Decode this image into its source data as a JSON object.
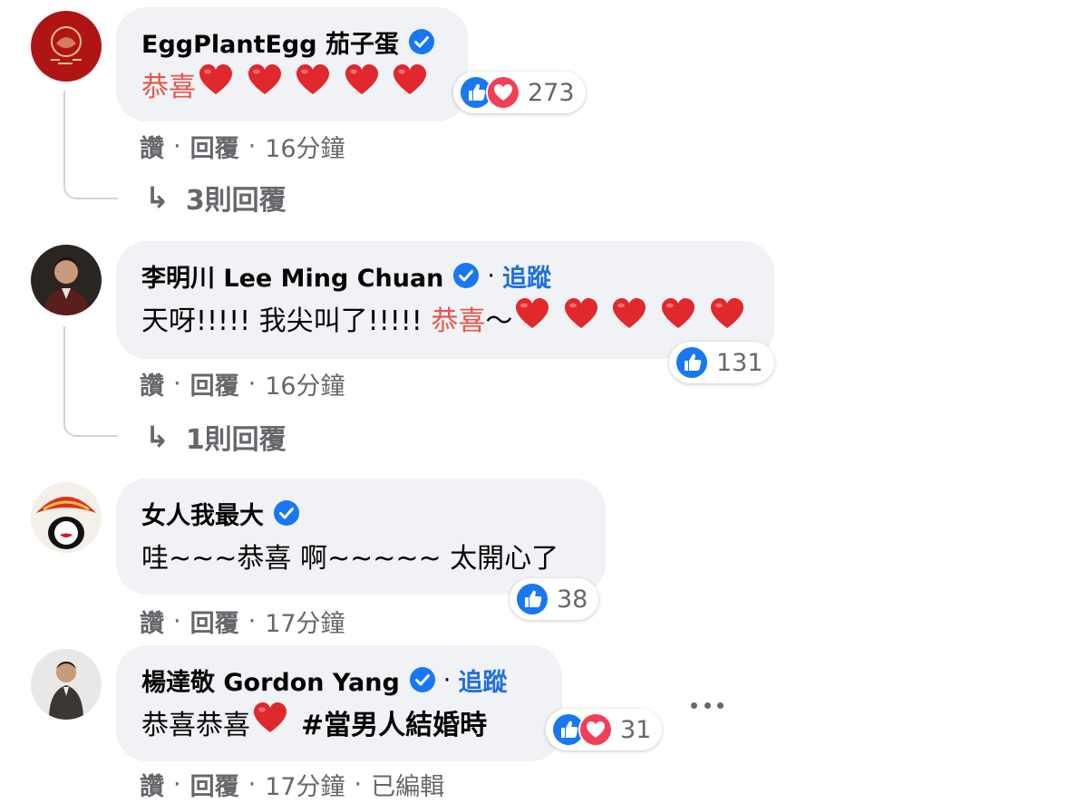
{
  "comments": [
    {
      "author": "EggPlantEgg 茄子蛋",
      "verified": true,
      "text_red": "恭喜",
      "text_pre": "",
      "text_post": "",
      "hearts": 5,
      "reactions": [
        "like",
        "love"
      ],
      "reaction_count": "273",
      "like_label": "讚",
      "reply_label": "回覆",
      "time": "16分鐘",
      "replies_label": "3則回覆"
    },
    {
      "author": "李明川 Lee Ming Chuan",
      "verified": true,
      "follow_label": "追蹤",
      "text_pre": "天呀!!!!! 我尖叫了!!!!! ",
      "text_red": "恭喜",
      "text_post": "～",
      "hearts": 5,
      "reactions": [
        "like"
      ],
      "reaction_count": "131",
      "like_label": "讚",
      "reply_label": "回覆",
      "time": "16分鐘",
      "replies_label": "1則回覆"
    },
    {
      "author": "女人我最大",
      "verified": true,
      "text_pre": "哇~~~恭喜 啊~~~~~ 太開心了",
      "hearts": 0,
      "reactions": [
        "like"
      ],
      "reaction_count": "38",
      "like_label": "讚",
      "reply_label": "回覆",
      "time": "17分鐘"
    },
    {
      "author": "楊達敬 Gordon Yang",
      "verified": true,
      "follow_label": "追蹤",
      "text_pre": "恭喜恭喜",
      "hashtag": "#當男人結婚時",
      "hearts": 1,
      "reactions": [
        "like",
        "love"
      ],
      "reaction_count": "31",
      "like_label": "讚",
      "reply_label": "回覆",
      "time": "17分鐘",
      "edited_label": "已編輯"
    }
  ],
  "separator": "·",
  "reply_arrow": "↳",
  "colors": {
    "bubble": "#f0f2f5",
    "link_blue": "#216fdb",
    "muted": "#65676b",
    "red_text": "#e4564a",
    "heart_red": "#e0282d",
    "verified_blue": "#1877f2"
  }
}
